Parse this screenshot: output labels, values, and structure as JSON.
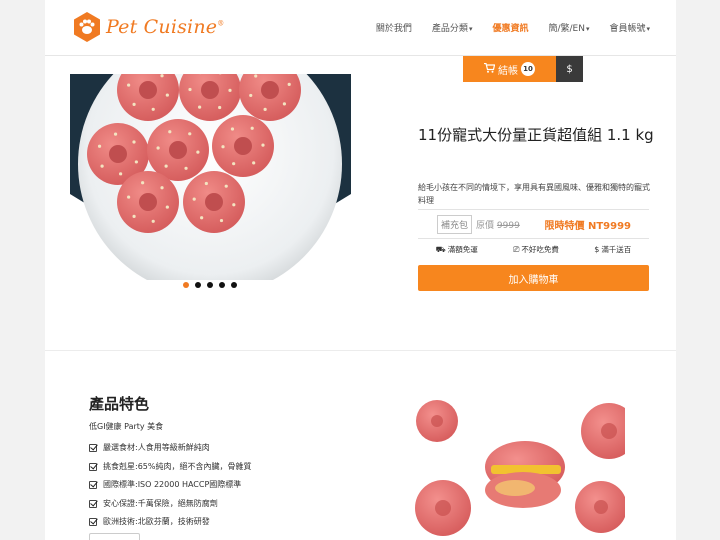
{
  "header": {
    "logo_text": "Pet Cuisine",
    "logo_reg": "®",
    "nav": [
      {
        "label": "關於我們",
        "has_caret": false,
        "active": false
      },
      {
        "label": "產品分類",
        "has_caret": true,
        "active": false
      },
      {
        "label": "優惠資訊",
        "has_caret": false,
        "active": true
      },
      {
        "label": "簡/繁/EN",
        "has_caret": true,
        "active": false
      },
      {
        "label": "會員帳號",
        "has_caret": true,
        "active": false
      }
    ]
  },
  "cart": {
    "label": "結帳",
    "count": "10",
    "currency": "$"
  },
  "carousel": {
    "slide_count": 5,
    "active_index": 0
  },
  "product": {
    "title": "11份寵式大份量正貨超值組 1.1 kg",
    "description": "給毛小孩在不同的情境下，享用具有異國風味、優雅和獨特的寵式料理",
    "refill_tag": "補充包",
    "original_label": "原價",
    "original_price": "9999",
    "sale_label": "限時特價 NT9999",
    "features": [
      {
        "icon": "truck-icon",
        "glyph": "⛟",
        "label": "滿額免運"
      },
      {
        "icon": "ticket-icon",
        "glyph": "⎚",
        "label": "不好吃免費"
      },
      {
        "icon": "dollar-icon",
        "glyph": "$",
        "label": "滿千送百"
      }
    ],
    "add_to_cart": "加入購物車"
  },
  "features_section": {
    "title": "產品特色",
    "subtitle": "低GI健康 Party 美食",
    "items": [
      "嚴選食材:人食用等級新鮮純肉",
      "挑食剋星:65%純肉，絕不含內臟，骨雜質",
      "國際標準:ISO 22000 HACCP國際標準",
      "安心保證:千萬保險，絕無防腐劑",
      "歐洲技術:北歐芬蘭，技術研發"
    ]
  },
  "colors": {
    "accent": "#f7861e",
    "dark": "#3a3a3a",
    "donut": "#e86d6d"
  }
}
